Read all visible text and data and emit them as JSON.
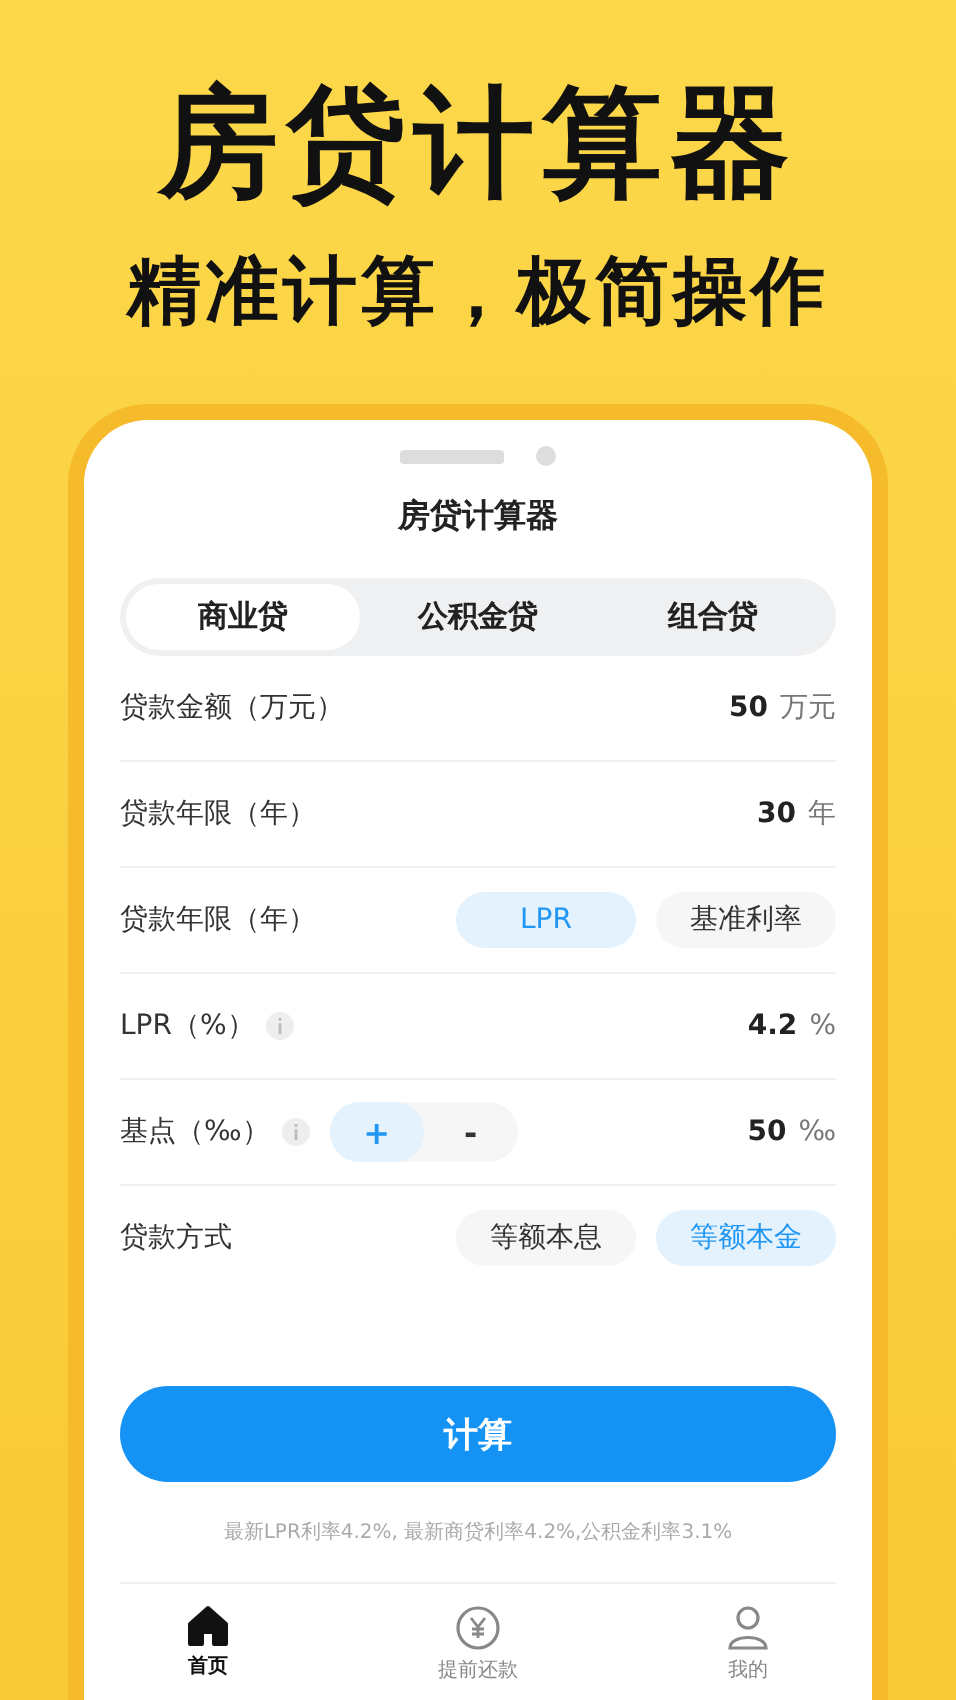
{
  "promo": {
    "headline": "房贷计算器",
    "subtitle": "精准计算，极简操作"
  },
  "screen": {
    "title": "房贷计算器",
    "tabs": [
      {
        "label": "商业贷",
        "selected": true
      },
      {
        "label": "公积金贷",
        "selected": false
      },
      {
        "label": "组合贷",
        "selected": false
      }
    ],
    "rows": [
      {
        "kind": "value",
        "label": "贷款金额（万元）",
        "value": "50",
        "unit": "万元"
      },
      {
        "kind": "value",
        "label": "贷款年限（年）",
        "value": "30",
        "unit": "年"
      },
      {
        "kind": "choice",
        "label": "贷款年限（年）",
        "options": [
          {
            "label": "LPR",
            "selected": true
          },
          {
            "label": "基准利率",
            "selected": false
          }
        ]
      },
      {
        "kind": "value",
        "label": "LPR（%）",
        "info": true,
        "value": "4.2",
        "unit": "%"
      },
      {
        "kind": "stepper",
        "label": "基点（‰）",
        "info": true,
        "options": [
          {
            "label": "+",
            "selected": true
          },
          {
            "label": "-",
            "selected": false
          }
        ],
        "value": "50",
        "unit": "‰"
      },
      {
        "kind": "choice",
        "label": "贷款方式",
        "options": [
          {
            "label": "等额本息",
            "selected": false
          },
          {
            "label": "等额本金",
            "selected": true
          }
        ]
      }
    ],
    "button": "计算",
    "note": "最新LPR利率4.2%, 最新商贷利率4.2%,公积金利率3.1%",
    "nav": [
      {
        "label": "首页",
        "kind": "home",
        "selected": true
      },
      {
        "label": "提前还款",
        "kind": "yen",
        "selected": false
      },
      {
        "label": "我的",
        "kind": "user",
        "selected": false
      }
    ]
  }
}
